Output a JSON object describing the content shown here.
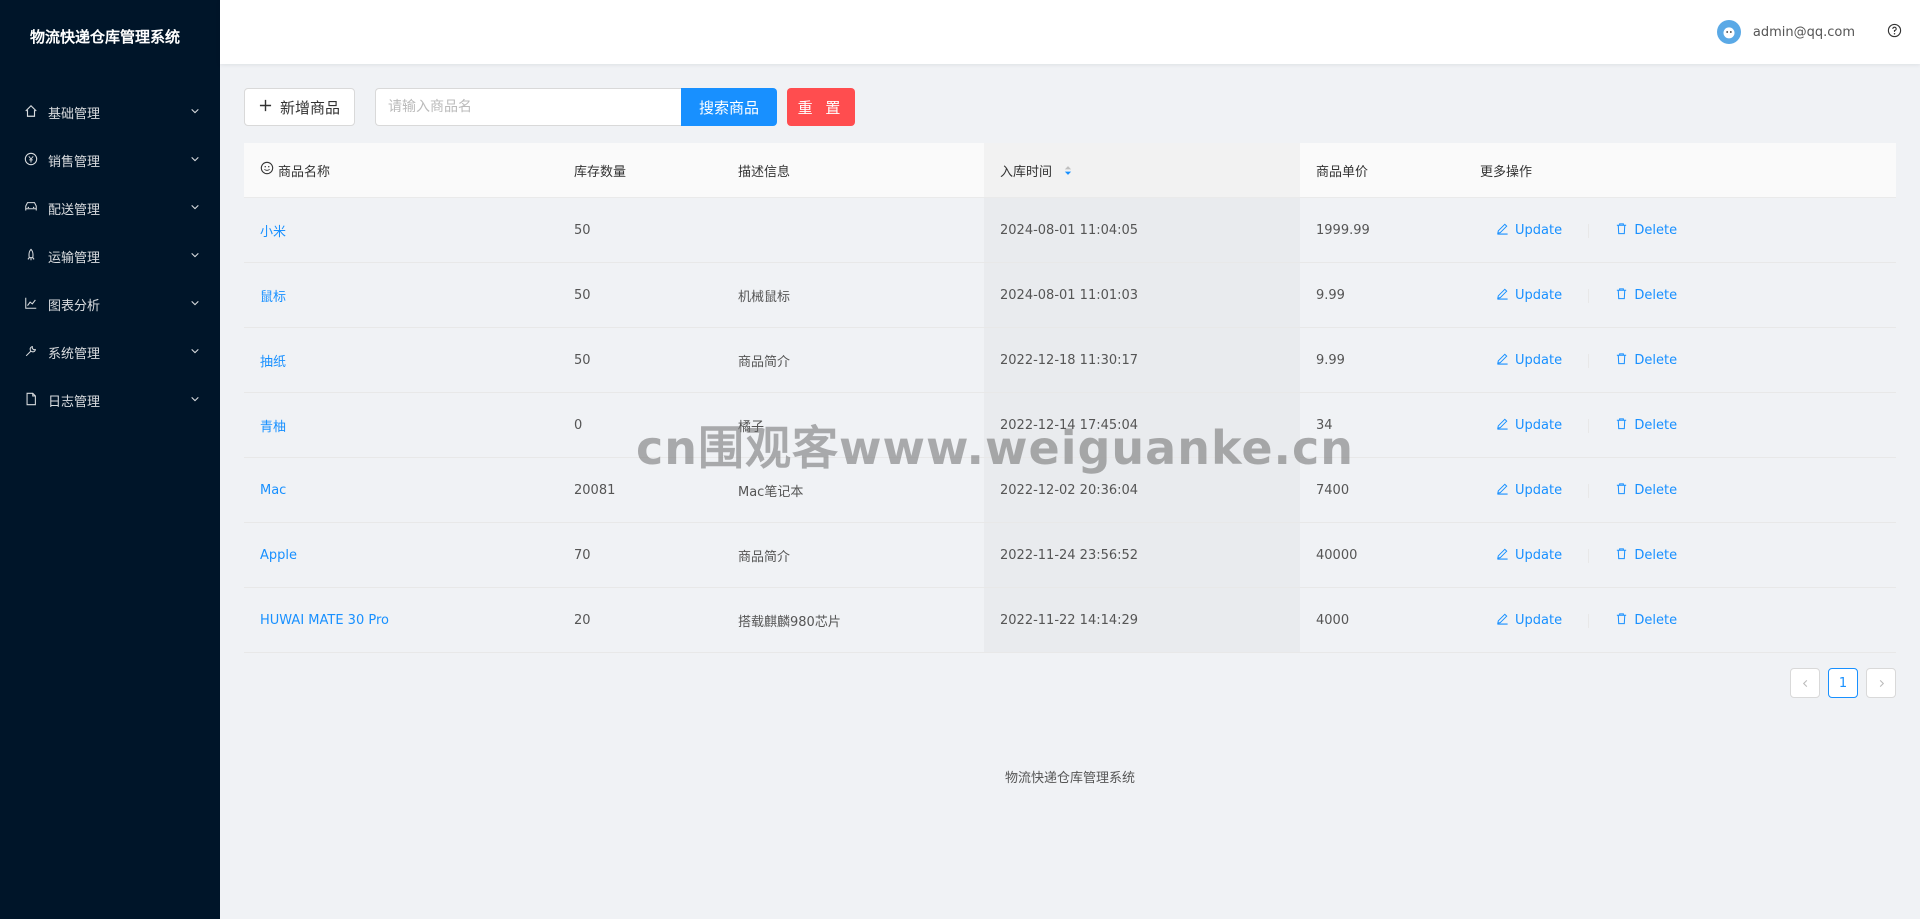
{
  "app": {
    "title": "物流快递仓库管理系统"
  },
  "sidebar": {
    "items": [
      {
        "label": "基础管理",
        "icon": "home-icon"
      },
      {
        "label": "销售管理",
        "icon": "yuan-icon"
      },
      {
        "label": "配送管理",
        "icon": "car-icon"
      },
      {
        "label": "运输管理",
        "icon": "rocket-icon"
      },
      {
        "label": "图表分析",
        "icon": "line-chart-icon"
      },
      {
        "label": "系统管理",
        "icon": "tool-icon"
      },
      {
        "label": "日志管理",
        "icon": "file-icon"
      }
    ]
  },
  "header": {
    "user": "admin@qq.com"
  },
  "toolbar": {
    "add_label": "新增商品",
    "search_placeholder": "请输入商品名",
    "search_label": "搜索商品",
    "reset_label": "重 置"
  },
  "table": {
    "columns": [
      "商品名称",
      "库存数量",
      "描述信息",
      "入库时间",
      "商品单价",
      "更多操作"
    ],
    "rows": [
      {
        "name": "小米",
        "stock": "50",
        "desc": "",
        "time": "2024-08-01 11:04:05",
        "price": "1999.99"
      },
      {
        "name": "鼠标",
        "stock": "50",
        "desc": "机械鼠标",
        "time": "2024-08-01 11:01:03",
        "price": "9.99"
      },
      {
        "name": "抽纸",
        "stock": "50",
        "desc": "商品简介",
        "time": "2022-12-18 11:30:17",
        "price": "9.99"
      },
      {
        "name": "青柚",
        "stock": "0",
        "desc": "橘子",
        "time": "2022-12-14 17:45:04",
        "price": "34"
      },
      {
        "name": "Mac",
        "stock": "20081",
        "desc": "Mac笔记本",
        "time": "2022-12-02 20:36:04",
        "price": "7400"
      },
      {
        "name": "Apple",
        "stock": "70",
        "desc": "商品简介",
        "time": "2022-11-24 23:56:52",
        "price": "40000"
      },
      {
        "name": "HUWAI MATE 30 Pro",
        "stock": "20",
        "desc": "搭载麒麟980芯片",
        "time": "2022-11-22 14:14:29",
        "price": "4000"
      }
    ],
    "update_label": "Update",
    "delete_label": "Delete"
  },
  "pagination": {
    "current": "1"
  },
  "footer": {
    "text": "物流快递仓库管理系统"
  },
  "watermark": {
    "text": "cn围观客www.weiguanke.cn"
  },
  "colors": {
    "sidebar": "#001529",
    "primary": "#1890ff",
    "danger": "#ff4d4f"
  }
}
